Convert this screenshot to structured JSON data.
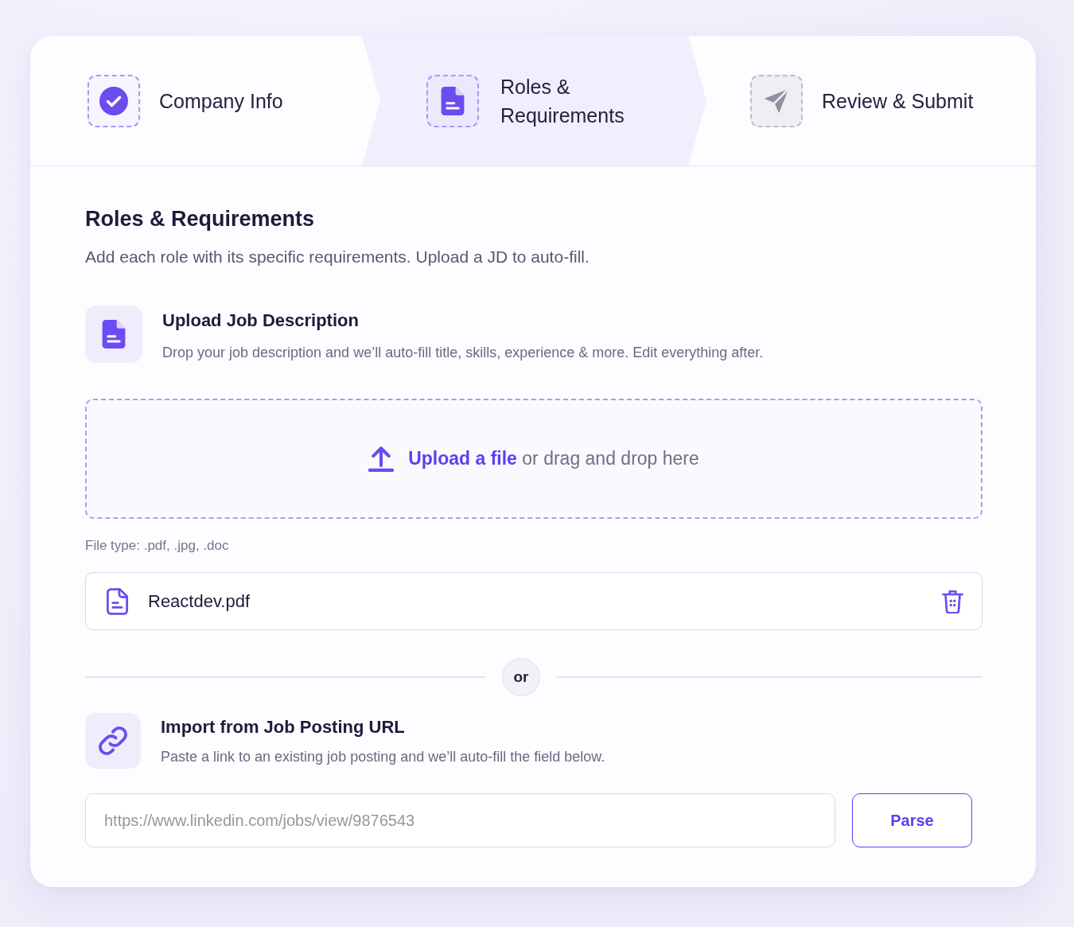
{
  "steps": [
    {
      "label": "Company Info",
      "completed": true,
      "selected": false
    },
    {
      "label": "Roles & Requirements",
      "completed": false,
      "selected": true
    },
    {
      "label": "Review & Submit",
      "completed": false,
      "selected": false
    }
  ],
  "page_heading": {
    "title": "Roles & Requirements",
    "subtitle": "Add each role with its specific requirements. Upload a JD to auto-fill."
  },
  "upload_section": {
    "title": "Upload Job Description",
    "description": "Drop your job description and we’ll auto-fill title, skills, experience & more. Edit everything after.",
    "dropzone": {
      "link": "Upload a file",
      "text": "or drag and drop here"
    },
    "file_types": "File type: .pdf, .jpg, .doc",
    "files": [
      {
        "name": "Reactdev.pdf"
      }
    ]
  },
  "divider": {
    "label": "or"
  },
  "url_section": {
    "title": "Import from Job Posting URL",
    "description": "Paste a link to an existing job posting and we’ll auto-fill the field below.",
    "url_field": {
      "placeholder": "https://www.linkedin.com/jobs/view/9876543"
    },
    "button": "Parse"
  }
}
